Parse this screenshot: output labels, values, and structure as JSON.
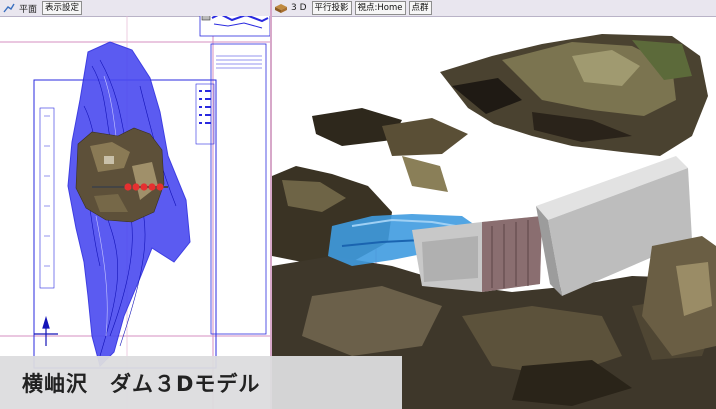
{
  "plan_view": {
    "title": "平面",
    "settings_button": "表示設定"
  },
  "view_3d": {
    "title": "3 D",
    "parallel_projection_button": "平行投影",
    "viewpoint_button": "視点:Home",
    "point_cloud_button": "点群"
  },
  "caption": "横岫沢　ダム３Dモデル",
  "colors": {
    "cad_lines": "#2a2adf",
    "cad_fill": "#4a4af0",
    "guide_lines": "#d68fc0",
    "caption_bg": "#dcdcde",
    "pier_red": "#e53030",
    "water_blue": "#3f9be0",
    "concrete": "#c8c8c8"
  },
  "icons": [
    "pen-plan-icon",
    "cube-3d-icon",
    "minimap-icon"
  ]
}
